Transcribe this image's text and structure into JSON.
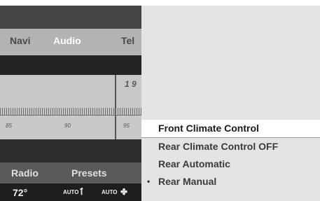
{
  "nav": {
    "items": [
      {
        "label": "Navi",
        "active": false
      },
      {
        "label": "Audio",
        "active": true
      },
      {
        "label": "Tel",
        "active": false
      }
    ]
  },
  "tuner": {
    "scale": [
      "85",
      "90",
      "95"
    ],
    "partial_value": "1 9"
  },
  "functions": {
    "items": [
      "Radio",
      "Presets"
    ]
  },
  "status": {
    "temperature": "72°",
    "left_auto": "AUTO",
    "right_auto": "AUTO"
  },
  "menu": {
    "items": [
      {
        "label": "Front Climate Control",
        "selected": true,
        "bullet": false
      },
      {
        "label": "Rear Climate Control OFF",
        "selected": false,
        "bullet": false
      },
      {
        "label": "Rear Automatic",
        "selected": false,
        "bullet": false
      },
      {
        "label": "Rear Manual",
        "selected": false,
        "bullet": true
      }
    ],
    "bullet_glyph": "•"
  },
  "colors": {
    "menu_background": "#e4e4e4",
    "selected_background": "#ffffff",
    "nav_background": "#b3b3b3",
    "active_nav_text": "#ffffff"
  }
}
